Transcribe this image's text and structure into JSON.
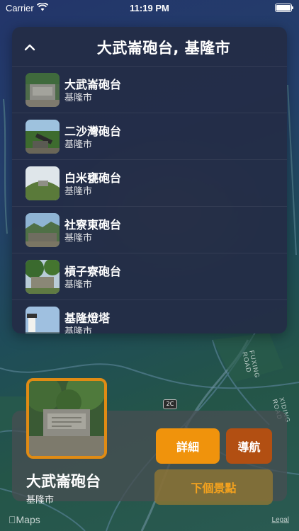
{
  "status_bar": {
    "carrier": "Carrier",
    "time": "11:19 PM"
  },
  "panel": {
    "title": "大武崙砲台, 基隆市",
    "collapse_icon": "chevron-up-icon",
    "items": [
      {
        "name": "大武崙砲台",
        "city": "基隆市"
      },
      {
        "name": "二沙灣砲台",
        "city": "基隆市"
      },
      {
        "name": "白米甕砲台",
        "city": "基隆市"
      },
      {
        "name": "社寮東砲台",
        "city": "基隆市"
      },
      {
        "name": "槓子寮砲台",
        "city": "基隆市"
      },
      {
        "name": "基隆燈塔",
        "city": "基隆市"
      }
    ]
  },
  "map": {
    "road_label_1": "FUXING ROAD",
    "road_label_2": "XIDING ROAD",
    "highway_shield": "2C",
    "attribution": "Maps",
    "legal": "Legal"
  },
  "card": {
    "name": "大武崙砲台",
    "city": "基隆市",
    "details_label": "詳細",
    "navigate_label": "導航",
    "next_label": "下個景點"
  },
  "colors": {
    "accent_orange": "#f0930c",
    "dark_orange": "#b24f12",
    "photo_border": "#e08b14"
  }
}
